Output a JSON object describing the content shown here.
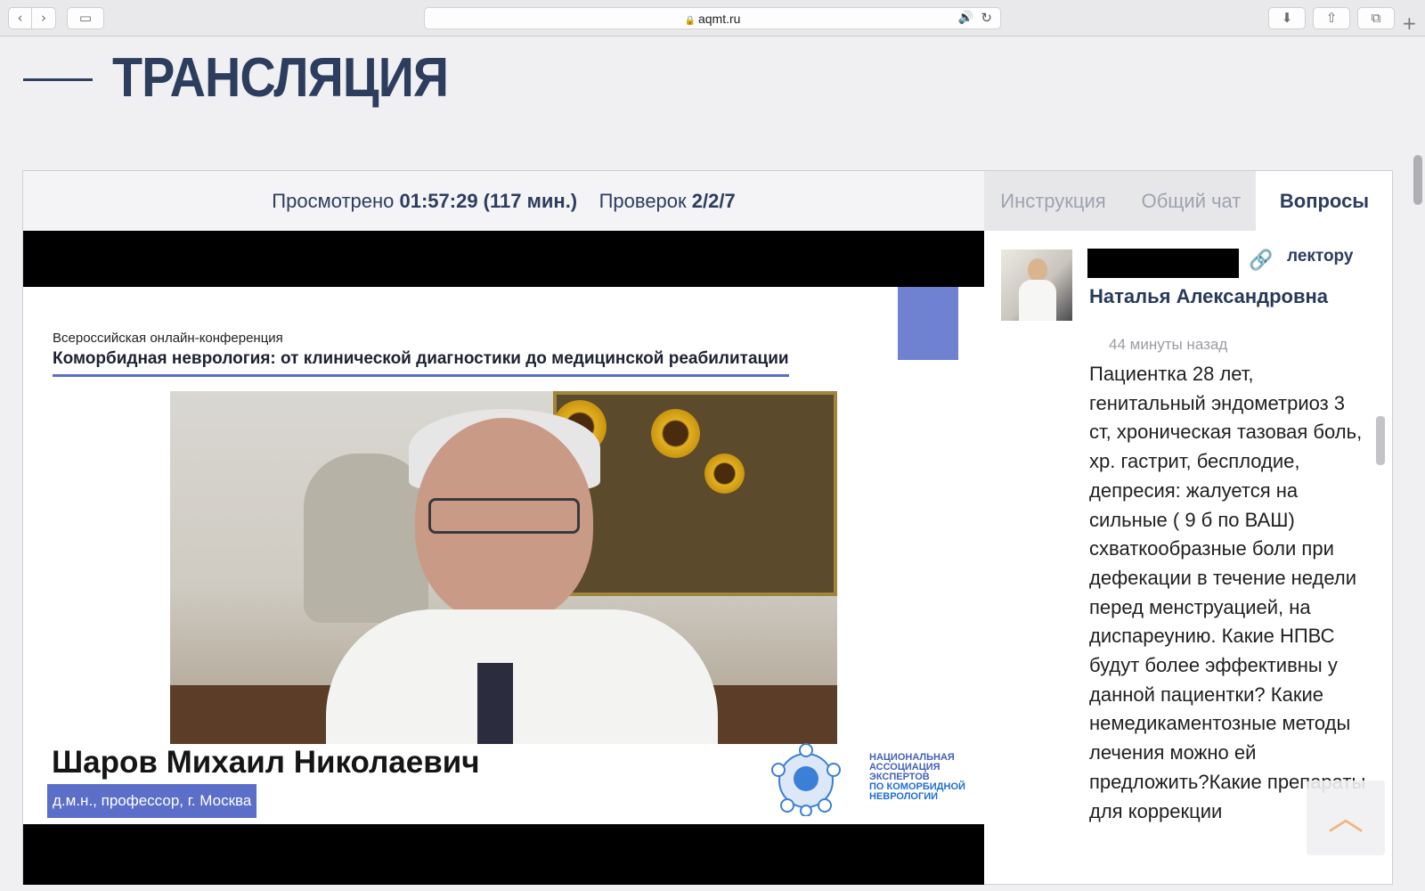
{
  "browser": {
    "url": "aqmt.ru",
    "back_icon": "‹",
    "forward_icon": "›",
    "sidebar_icon": "▭",
    "lock_icon": "🔒",
    "speaker_icon": "🔊",
    "reload_icon": "↻",
    "download_icon": "⬇",
    "share_icon": "⇧",
    "tabs_icon": "⧉",
    "new_tab_icon": "+"
  },
  "page": {
    "title": "ТРАНСЛЯЦИЯ"
  },
  "stats": {
    "watched_label": "Просмотрено",
    "watched_value": "01:57:29 (117 мин.)",
    "checks_label": "Проверок",
    "checks_value": "2/2/7"
  },
  "slide": {
    "conference_subtitle": "Всероссийская онлайн-конференция",
    "conference_title": "Коморбидная неврология: от клинической диагностики до медицинской реабилитации",
    "speaker_name": "Шаров Михаил Николаевич",
    "speaker_role": "д.м.н., профессор, г. Москва",
    "logo_lines": [
      "НАЦИОНАЛЬНАЯ",
      "АССОЦИАЦИЯ",
      "ЭКСПЕРТОВ",
      "ПО КОМОРБИДНОЙ",
      "НЕВРОЛОГИИ"
    ]
  },
  "sidebar": {
    "tabs": [
      {
        "label": "Инструкция",
        "active": false
      },
      {
        "label": "Общий чат",
        "active": false
      },
      {
        "label": "Вопросы",
        "active": true
      }
    ],
    "question": {
      "link_icon": "🔗",
      "recipient": "лектору",
      "author_name": "Наталья Александровна",
      "time": "44 минуты назад",
      "text": "Пациентка 28 лет, генитальный эндометриоз 3 ст, хроническая тазовая боль, хр. гастрит, бесплодие, депресия: жалуется на сильные ( 9 б по ВАШ) схваткообразные боли при дефекации в течение недели перед менструацией, на диспареунию. Какие НПВС будут более эффективны у данной пациентки? Какие немедикаментозные методы лечения можно ей предложить?Какие препараты для коррекции"
    },
    "scroll_top_icon": "︿"
  },
  "colors": {
    "title": "#2d3d5e",
    "accent": "#5b6fc8",
    "active_tab": "#2c3d5e"
  }
}
